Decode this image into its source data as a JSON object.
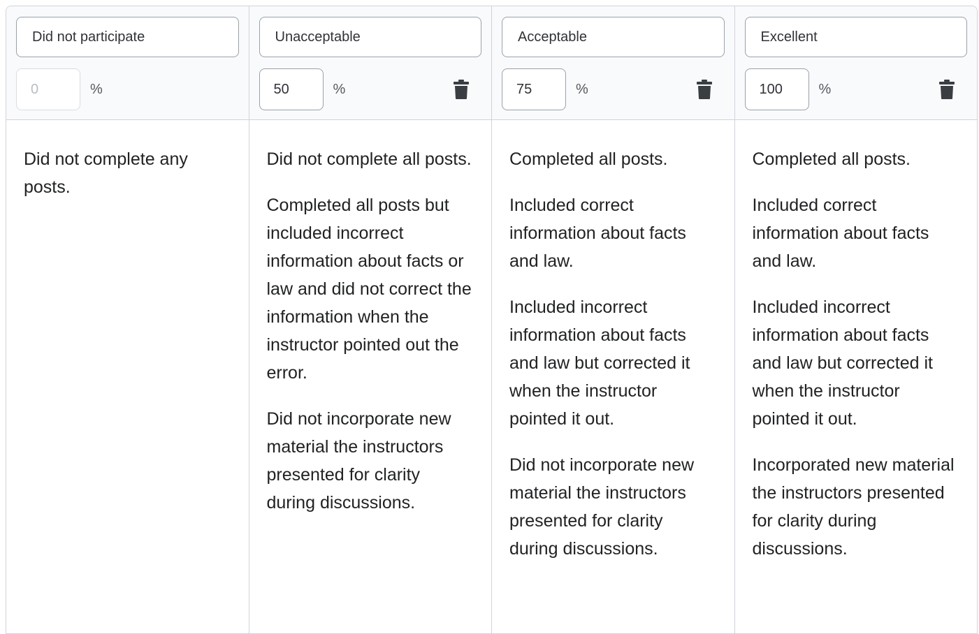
{
  "levels": [
    {
      "name": "Did not participate",
      "percent": "0",
      "percent_unit": "%",
      "deletable": false,
      "description": [
        "Did not complete any posts."
      ]
    },
    {
      "name": "Unacceptable",
      "percent": "50",
      "percent_unit": "%",
      "deletable": true,
      "description": [
        "Did not complete all posts.",
        "Completed all posts but included incorrect information about facts or law and did not correct the information when the instructor pointed out the error.",
        "Did not incorporate new material the instructors presented for clarity during discussions."
      ]
    },
    {
      "name": "Acceptable",
      "percent": "75",
      "percent_unit": "%",
      "deletable": true,
      "description": [
        "Completed all posts.",
        "Included correct information about facts and law.",
        "Included incorrect information about facts and law but corrected it when the instructor pointed it out.",
        "Did not incorporate new material the instructors presented for clarity during discussions."
      ]
    },
    {
      "name": "Excellent",
      "percent": "100",
      "percent_unit": "%",
      "deletable": true,
      "description": [
        "Completed all posts.",
        "Included correct information about facts and law.",
        "Included incorrect information about facts and law but corrected it when the instructor pointed it out.",
        "Incorporated new material the instructors presented for clarity during discussions."
      ]
    }
  ],
  "icons": {
    "delete": "trash-icon"
  },
  "colors": {
    "border": "#cfd4da",
    "header_bg": "#f9fafc",
    "input_border": "#9aa1a9",
    "text": "#202224",
    "icon": "#3a3d41"
  }
}
